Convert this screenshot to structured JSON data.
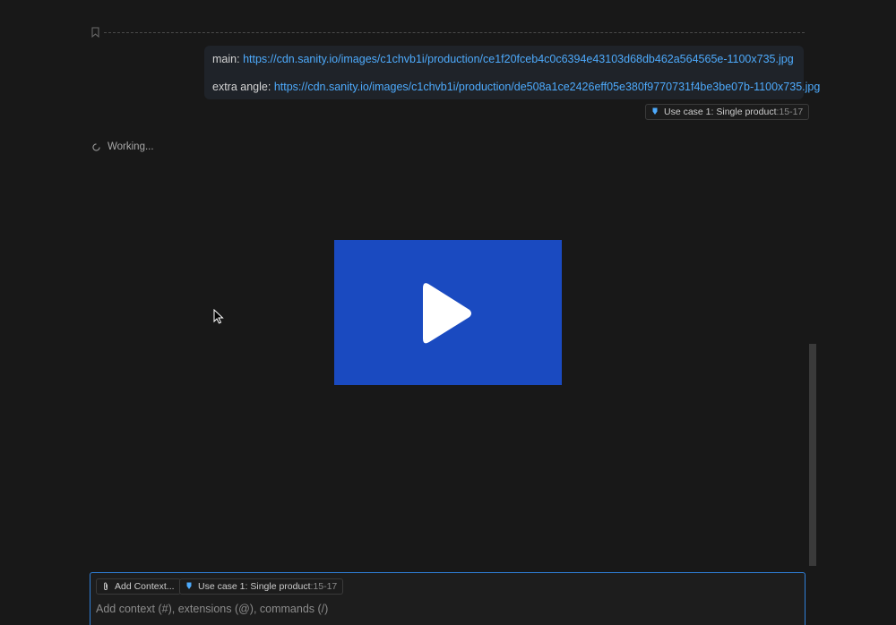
{
  "message": {
    "lines": [
      {
        "label": "main:",
        "url": "https://cdn.sanity.io/images/c1chvb1i/production/ce1f20fceb4c0c6394e43103d68db462a564565e-1100x735.jpg"
      },
      {
        "label": "extra angle:",
        "url": "https://cdn.sanity.io/images/c1chvb1i/production/de508a1ce2426eff05e380f9770731f4be3be07b-1100x735.jpg"
      }
    ],
    "context_chip": {
      "label": "Use case 1: Single product",
      "lines": ":15-17"
    }
  },
  "status": {
    "text": "Working..."
  },
  "video": {
    "icon": "play-icon"
  },
  "input_panel": {
    "add_context_label": "Add Context...",
    "context_chip": {
      "label": "Use case 1: Single product",
      "lines": ":15-17"
    },
    "placeholder": "Add context (#), extensions (@), commands (/)"
  },
  "colors": {
    "background": "#181818",
    "link": "#4daafc",
    "video_background": "#1a4ac0",
    "focus_border": "#2f80d9"
  }
}
